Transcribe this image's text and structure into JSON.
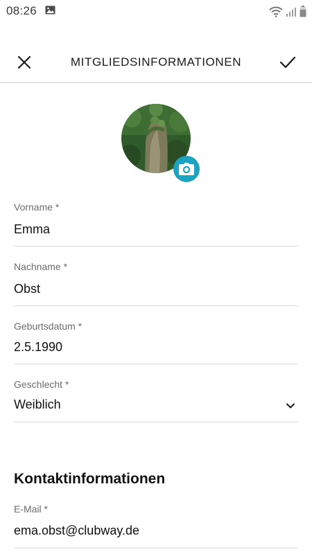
{
  "status_bar": {
    "time": "08:26",
    "icons": [
      "gallery-icon",
      "wifi-icon",
      "signal-icon",
      "battery-icon"
    ]
  },
  "app_bar": {
    "title": "MITGLIEDSINFORMATIONEN",
    "close_icon": "close-icon",
    "confirm_icon": "checkmark-icon"
  },
  "avatar": {
    "camera_icon": "camera-icon",
    "accent_color": "#1ba3bf"
  },
  "fields": {
    "vorname": {
      "label": "Vorname *",
      "value": "Emma"
    },
    "nachname": {
      "label": "Nachname *",
      "value": "Obst"
    },
    "geburtsdatum": {
      "label": "Geburtsdatum *",
      "value": "2.5.1990"
    },
    "geschlecht": {
      "label": "Geschlecht *",
      "value": "Weiblich",
      "icon": "chevron-down-icon"
    }
  },
  "contact": {
    "title": "Kontaktinformationen",
    "email": {
      "label": "E-Mail *",
      "value": "ema.obst@clubway.de"
    }
  }
}
